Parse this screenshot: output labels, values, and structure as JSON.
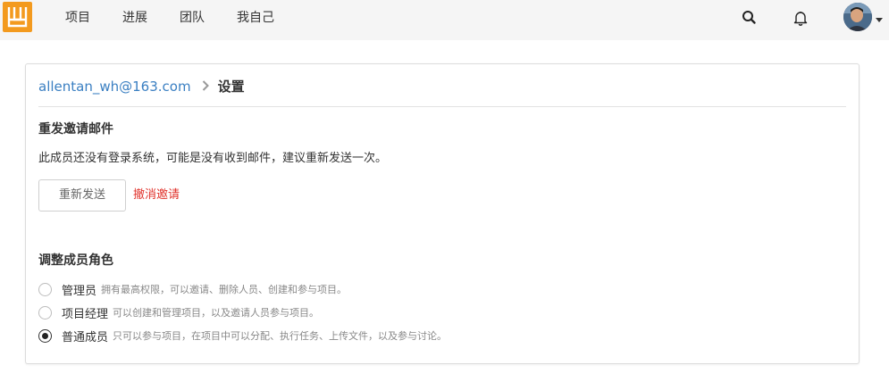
{
  "nav": {
    "items": [
      {
        "label": "项目"
      },
      {
        "label": "进展"
      },
      {
        "label": "团队"
      },
      {
        "label": "我自己"
      }
    ],
    "icons": [
      "search-icon",
      "bell-icon"
    ]
  },
  "breadcrumb": {
    "email": "allentan_wh@163.com",
    "separator": "›",
    "current": "设置"
  },
  "resend": {
    "title": "重发邀请邮件",
    "description": "此成员还没有登录系统，可能是没有收到邮件，建议重新发送一次。",
    "resend_label": "重新发送",
    "cancel_label": "撤消邀请"
  },
  "roles": {
    "title": "调整成员角色",
    "options": [
      {
        "name": "管理员",
        "desc": "拥有最高权限，可以邀请、删除人员、创建和参与项目。",
        "checked": false
      },
      {
        "name": "项目经理",
        "desc": "可以创建和管理项目，以及邀请人员参与项目。",
        "checked": false
      },
      {
        "name": "普通成员",
        "desc": "只可以参与项目，在项目中可以分配、执行任务、上传文件，以及参与讨论。",
        "checked": true
      }
    ]
  },
  "colors": {
    "brand": "#f39a1e",
    "link": "#3a7fc2",
    "danger": "#e0322b"
  }
}
